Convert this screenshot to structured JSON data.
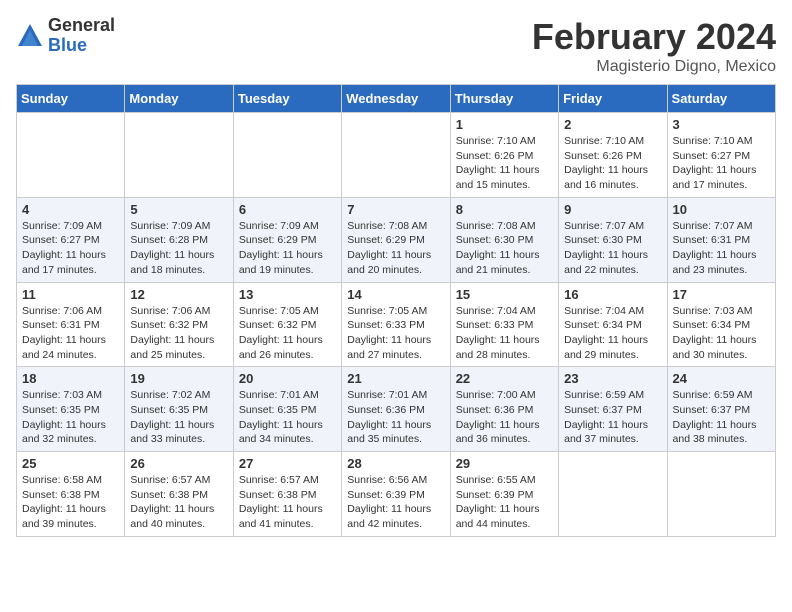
{
  "logo": {
    "general": "General",
    "blue": "Blue"
  },
  "title": "February 2024",
  "subtitle": "Magisterio Digno, Mexico",
  "days_of_week": [
    "Sunday",
    "Monday",
    "Tuesday",
    "Wednesday",
    "Thursday",
    "Friday",
    "Saturday"
  ],
  "weeks": [
    [
      {
        "day": "",
        "info": ""
      },
      {
        "day": "",
        "info": ""
      },
      {
        "day": "",
        "info": ""
      },
      {
        "day": "",
        "info": ""
      },
      {
        "day": "1",
        "info": "Sunrise: 7:10 AM\nSunset: 6:26 PM\nDaylight: 11 hours and 15 minutes."
      },
      {
        "day": "2",
        "info": "Sunrise: 7:10 AM\nSunset: 6:26 PM\nDaylight: 11 hours and 16 minutes."
      },
      {
        "day": "3",
        "info": "Sunrise: 7:10 AM\nSunset: 6:27 PM\nDaylight: 11 hours and 17 minutes."
      }
    ],
    [
      {
        "day": "4",
        "info": "Sunrise: 7:09 AM\nSunset: 6:27 PM\nDaylight: 11 hours and 17 minutes."
      },
      {
        "day": "5",
        "info": "Sunrise: 7:09 AM\nSunset: 6:28 PM\nDaylight: 11 hours and 18 minutes."
      },
      {
        "day": "6",
        "info": "Sunrise: 7:09 AM\nSunset: 6:29 PM\nDaylight: 11 hours and 19 minutes."
      },
      {
        "day": "7",
        "info": "Sunrise: 7:08 AM\nSunset: 6:29 PM\nDaylight: 11 hours and 20 minutes."
      },
      {
        "day": "8",
        "info": "Sunrise: 7:08 AM\nSunset: 6:30 PM\nDaylight: 11 hours and 21 minutes."
      },
      {
        "day": "9",
        "info": "Sunrise: 7:07 AM\nSunset: 6:30 PM\nDaylight: 11 hours and 22 minutes."
      },
      {
        "day": "10",
        "info": "Sunrise: 7:07 AM\nSunset: 6:31 PM\nDaylight: 11 hours and 23 minutes."
      }
    ],
    [
      {
        "day": "11",
        "info": "Sunrise: 7:06 AM\nSunset: 6:31 PM\nDaylight: 11 hours and 24 minutes."
      },
      {
        "day": "12",
        "info": "Sunrise: 7:06 AM\nSunset: 6:32 PM\nDaylight: 11 hours and 25 minutes."
      },
      {
        "day": "13",
        "info": "Sunrise: 7:05 AM\nSunset: 6:32 PM\nDaylight: 11 hours and 26 minutes."
      },
      {
        "day": "14",
        "info": "Sunrise: 7:05 AM\nSunset: 6:33 PM\nDaylight: 11 hours and 27 minutes."
      },
      {
        "day": "15",
        "info": "Sunrise: 7:04 AM\nSunset: 6:33 PM\nDaylight: 11 hours and 28 minutes."
      },
      {
        "day": "16",
        "info": "Sunrise: 7:04 AM\nSunset: 6:34 PM\nDaylight: 11 hours and 29 minutes."
      },
      {
        "day": "17",
        "info": "Sunrise: 7:03 AM\nSunset: 6:34 PM\nDaylight: 11 hours and 30 minutes."
      }
    ],
    [
      {
        "day": "18",
        "info": "Sunrise: 7:03 AM\nSunset: 6:35 PM\nDaylight: 11 hours and 32 minutes."
      },
      {
        "day": "19",
        "info": "Sunrise: 7:02 AM\nSunset: 6:35 PM\nDaylight: 11 hours and 33 minutes."
      },
      {
        "day": "20",
        "info": "Sunrise: 7:01 AM\nSunset: 6:35 PM\nDaylight: 11 hours and 34 minutes."
      },
      {
        "day": "21",
        "info": "Sunrise: 7:01 AM\nSunset: 6:36 PM\nDaylight: 11 hours and 35 minutes."
      },
      {
        "day": "22",
        "info": "Sunrise: 7:00 AM\nSunset: 6:36 PM\nDaylight: 11 hours and 36 minutes."
      },
      {
        "day": "23",
        "info": "Sunrise: 6:59 AM\nSunset: 6:37 PM\nDaylight: 11 hours and 37 minutes."
      },
      {
        "day": "24",
        "info": "Sunrise: 6:59 AM\nSunset: 6:37 PM\nDaylight: 11 hours and 38 minutes."
      }
    ],
    [
      {
        "day": "25",
        "info": "Sunrise: 6:58 AM\nSunset: 6:38 PM\nDaylight: 11 hours and 39 minutes."
      },
      {
        "day": "26",
        "info": "Sunrise: 6:57 AM\nSunset: 6:38 PM\nDaylight: 11 hours and 40 minutes."
      },
      {
        "day": "27",
        "info": "Sunrise: 6:57 AM\nSunset: 6:38 PM\nDaylight: 11 hours and 41 minutes."
      },
      {
        "day": "28",
        "info": "Sunrise: 6:56 AM\nSunset: 6:39 PM\nDaylight: 11 hours and 42 minutes."
      },
      {
        "day": "29",
        "info": "Sunrise: 6:55 AM\nSunset: 6:39 PM\nDaylight: 11 hours and 44 minutes."
      },
      {
        "day": "",
        "info": ""
      },
      {
        "day": "",
        "info": ""
      }
    ]
  ]
}
